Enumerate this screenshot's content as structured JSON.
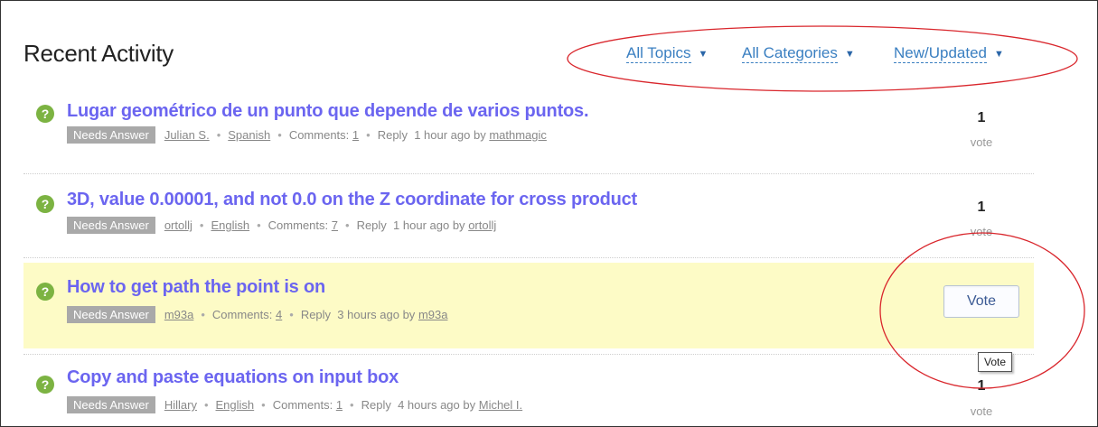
{
  "header": {
    "title": "Recent Activity",
    "filters": [
      {
        "label": "All Topics"
      },
      {
        "label": "All Categories"
      },
      {
        "label": "New/Updated"
      }
    ]
  },
  "items": [
    {
      "title": "Lugar geométrico de un punto que depende de varios puntos.",
      "badge": "Needs Answer",
      "author": "Julian S.",
      "language": "Spanish",
      "comments_label": "Comments:",
      "comments": "1",
      "reply": "Reply",
      "time": "1 hour ago by",
      "by": "mathmagic",
      "votes": "1",
      "vote_label": "vote"
    },
    {
      "title": "3D, value 0.00001, and not 0.0 on the Z coordinate for cross product",
      "badge": "Needs Answer",
      "author": "ortollj",
      "language": "English",
      "comments_label": "Comments:",
      "comments": "7",
      "reply": "Reply",
      "time": "1 hour ago by",
      "by": "ortollj",
      "votes": "1",
      "vote_label": "vote"
    },
    {
      "title": "How to get path the point is on",
      "badge": "Needs Answer",
      "author": "m93a",
      "comments_label": "Comments:",
      "comments": "4",
      "reply": "Reply",
      "time": "3 hours ago by",
      "by": "m93a",
      "vote_button": "Vote",
      "tooltip": "Vote"
    },
    {
      "title": "Copy and paste equations on input box",
      "badge": "Needs Answer",
      "author": "Hillary",
      "language": "English",
      "comments_label": "Comments:",
      "comments": "1",
      "reply": "Reply",
      "time": "4 hours ago by",
      "by": "Michel I.",
      "votes": "1",
      "vote_label": "vote"
    }
  ],
  "colors": {
    "title_link": "#6b65f0",
    "filter_link": "#3a7fc1",
    "highlight_row": "#fdfbc6",
    "answer_icon": "#7cb342",
    "annotation": "#d9262c"
  },
  "icons": {
    "question": "question-mark-icon",
    "dropdown": "caret-down-icon"
  }
}
